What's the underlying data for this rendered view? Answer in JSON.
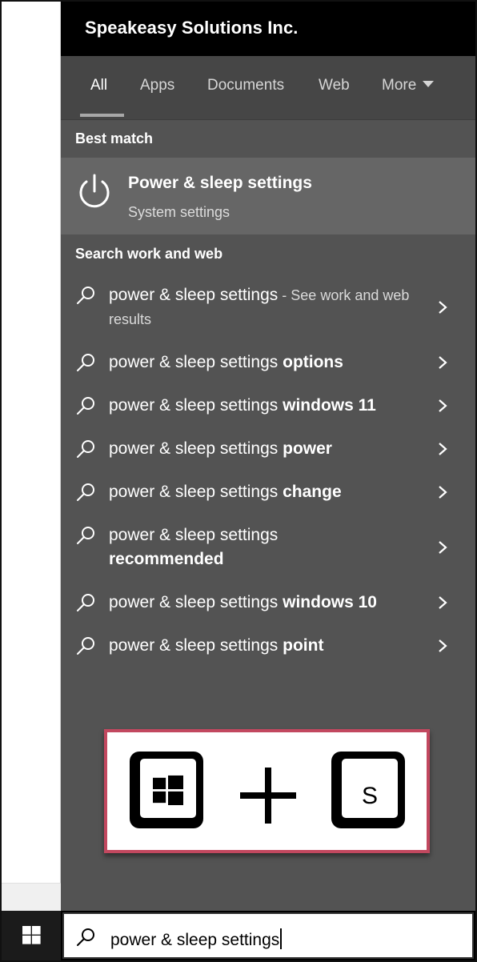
{
  "header": {
    "org_name": "Speakeasy Solutions Inc."
  },
  "tabs": [
    {
      "label": "All",
      "active": true
    },
    {
      "label": "Apps",
      "active": false
    },
    {
      "label": "Documents",
      "active": false
    },
    {
      "label": "Web",
      "active": false
    },
    {
      "label": "More",
      "active": false
    }
  ],
  "sections": {
    "best_match": "Best match",
    "search_web": "Search work and web"
  },
  "best_match": {
    "icon": "power-icon",
    "title": "Power & sleep settings",
    "subtitle": "System settings"
  },
  "results": [
    {
      "base": "power & sleep settings",
      "bold": "",
      "hint": " - See work and web results"
    },
    {
      "base": "power & sleep settings ",
      "bold": "options",
      "hint": ""
    },
    {
      "base": "power & sleep settings ",
      "bold": "windows 11",
      "hint": ""
    },
    {
      "base": "power & sleep settings ",
      "bold": "power",
      "hint": ""
    },
    {
      "base": "power & sleep settings ",
      "bold": "change",
      "hint": ""
    },
    {
      "base": "power & sleep settings ",
      "bold": "recommended",
      "hint": ""
    },
    {
      "base": "power & sleep settings ",
      "bold": "windows 10",
      "hint": ""
    },
    {
      "base": "power & sleep settings ",
      "bold": "point",
      "hint": ""
    }
  ],
  "shortcut": {
    "key1": "windows-key",
    "key2_label": "S"
  },
  "search": {
    "value": "power & sleep settings"
  },
  "colors": {
    "panel": "#535353",
    "highlight": "#666666",
    "accent_border": "#c2485f"
  }
}
